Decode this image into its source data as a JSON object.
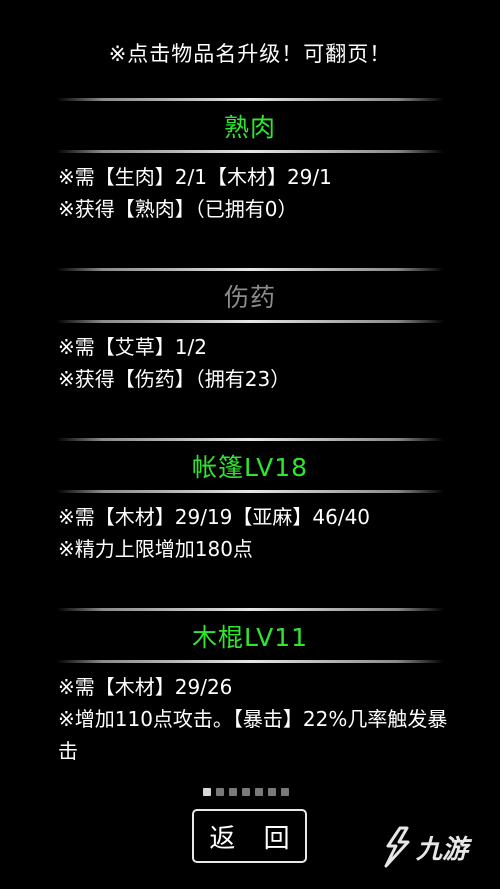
{
  "hint": "※点击物品名升级！可翻页！",
  "items": [
    {
      "title": "熟肉",
      "title_color": "#2fe52f",
      "lines": [
        "※需【生肉】2/1【木材】29/1",
        "※获得【熟肉】（已拥有0）"
      ]
    },
    {
      "title": "伤药",
      "title_color": "#8c8c8c",
      "lines": [
        "※需【艾草】1/2",
        "※获得【伤药】（拥有23）"
      ]
    },
    {
      "title": "帐篷LV18",
      "title_color": "#2fe52f",
      "lines": [
        "※需【木材】29/19【亚麻】46/40",
        "※精力上限增加180点"
      ]
    },
    {
      "title": "木棍LV11",
      "title_color": "#2fe52f",
      "lines": [
        "※需【木材】29/26",
        "※增加110点攻击。【暴击】22%几率触发暴击"
      ]
    }
  ],
  "pagination": {
    "total_pages": 7,
    "current_page": 1
  },
  "back_button": "返 回",
  "watermark": {
    "text": "九游",
    "icon": "jiuyou-logo-icon"
  }
}
